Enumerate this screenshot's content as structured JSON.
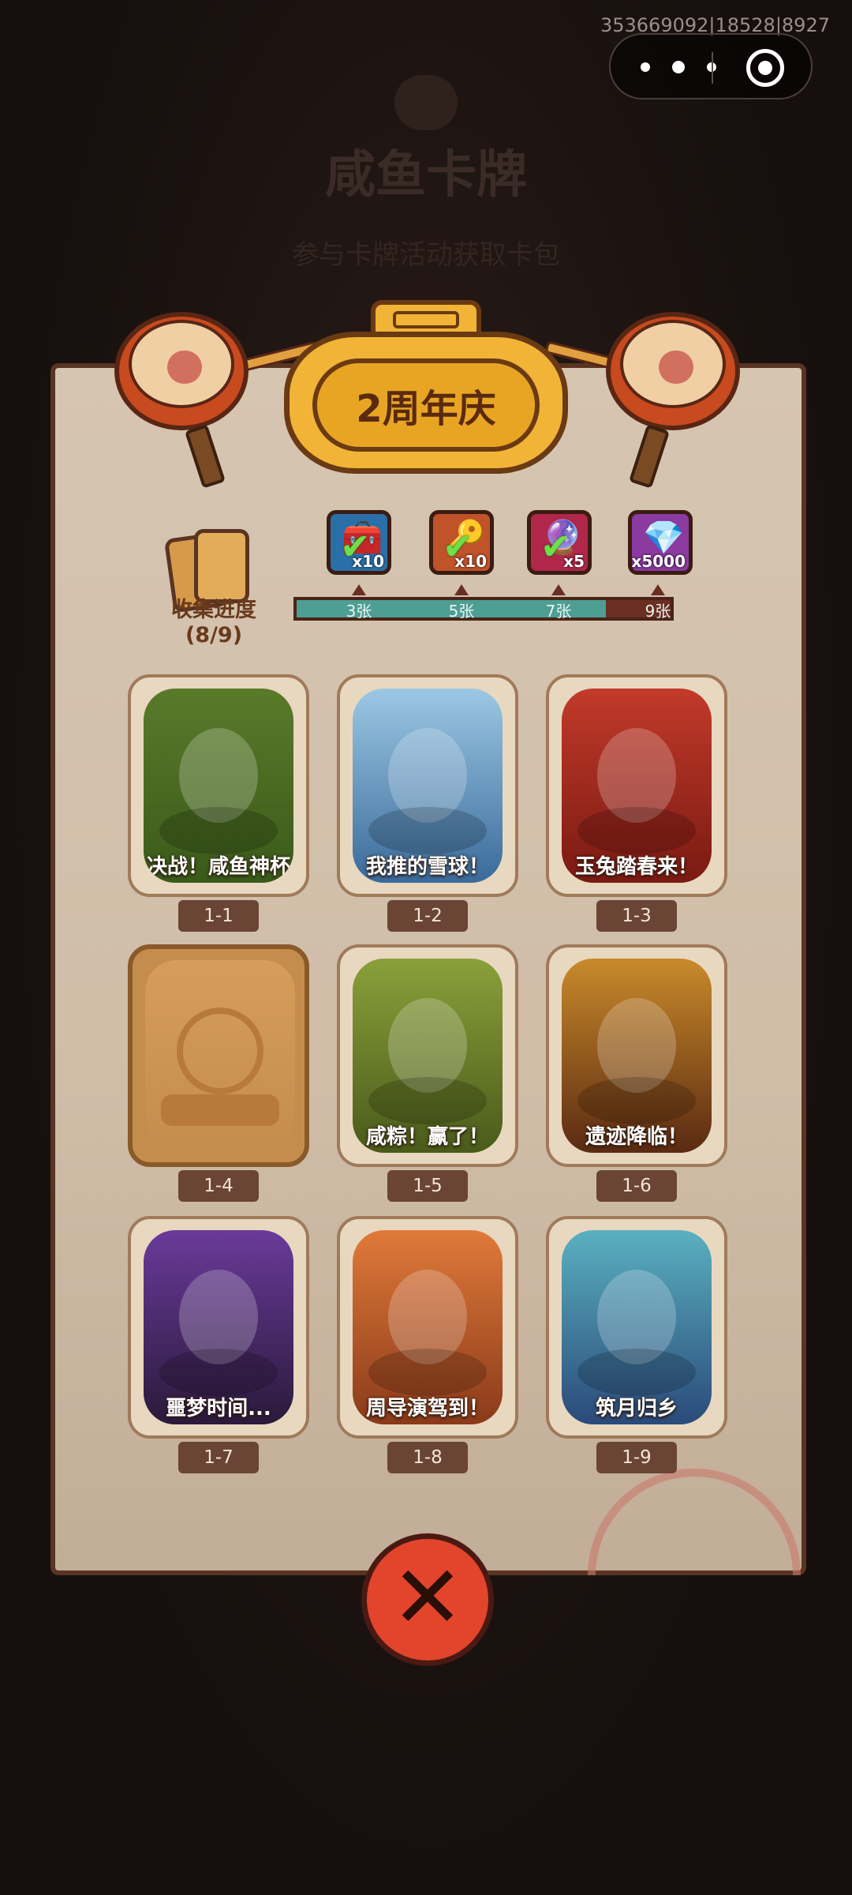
{
  "system": {
    "debug_id": "353669092|18528|8927"
  },
  "background": {
    "title": "咸鱼卡牌",
    "subtitle": "参与卡牌活动获取卡包"
  },
  "banner": {
    "title": "2周年庆"
  },
  "collection": {
    "label": "收集进度(8/9)",
    "collected": 8,
    "total": 9,
    "rewards": [
      {
        "icon": "treasure-chest-icon",
        "glyph": "🧰",
        "qty": "x10",
        "claimed": true,
        "bg": "#2b6fa8"
      },
      {
        "icon": "golden-key-icon",
        "glyph": "🔑",
        "qty": "x10",
        "claimed": true,
        "bg": "#c0532a"
      },
      {
        "icon": "magic-orb-icon",
        "glyph": "🔮",
        "qty": "x5",
        "claimed": true,
        "bg": "#b0274a"
      },
      {
        "icon": "diamond-icon",
        "glyph": "💎",
        "qty": "x5000",
        "claimed": false,
        "bg": "#8b3aa0"
      }
    ],
    "milestones": [
      "3张",
      "5张",
      "7张",
      "9张"
    ]
  },
  "cards": [
    {
      "id": "1-1",
      "title": "决战！咸鱼神杯",
      "unlocked": true,
      "bg": [
        "#5a7a2a",
        "#3a5a1a"
      ]
    },
    {
      "id": "1-2",
      "title": "我推的雪球！",
      "unlocked": true,
      "bg": [
        "#9cc8e4",
        "#3a6a9a"
      ]
    },
    {
      "id": "1-3",
      "title": "玉兔踏春来！",
      "unlocked": true,
      "bg": [
        "#c23a2a",
        "#7a1a12"
      ]
    },
    {
      "id": "1-4",
      "title": "",
      "unlocked": false,
      "bg": [
        "#d69d5a",
        "#c48d4d"
      ]
    },
    {
      "id": "1-5",
      "title": "咸粽！赢了！",
      "unlocked": true,
      "bg": [
        "#8aa03a",
        "#4a5a1a"
      ]
    },
    {
      "id": "1-6",
      "title": "遗迹降临！",
      "unlocked": true,
      "bg": [
        "#c98a2a",
        "#5a2a12"
      ]
    },
    {
      "id": "1-7",
      "title": "噩梦时间...",
      "unlocked": true,
      "bg": [
        "#6a3a9a",
        "#2a1a3a"
      ]
    },
    {
      "id": "1-8",
      "title": "周导演驾到！",
      "unlocked": true,
      "bg": [
        "#e07a3a",
        "#8a3a1a"
      ]
    },
    {
      "id": "1-9",
      "title": "筑月归乡",
      "unlocked": true,
      "bg": [
        "#5ab0c0",
        "#2a4a7a"
      ]
    }
  ]
}
